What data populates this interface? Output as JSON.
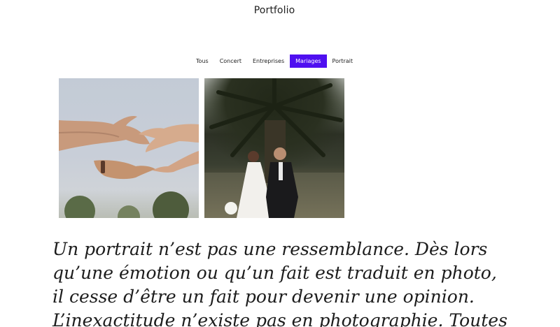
{
  "header": {
    "title": "Portfolio"
  },
  "filters": [
    {
      "label": "Tous",
      "active": false
    },
    {
      "label": "Concert",
      "active": false
    },
    {
      "label": "Entreprises",
      "active": false
    },
    {
      "label": "Mariages",
      "active": true
    },
    {
      "label": "Portrait",
      "active": false
    }
  ],
  "colors": {
    "accent": "#4f0ff0",
    "text": "#1b1b1b",
    "background": "#ffffff"
  },
  "quote": {
    "text": "Un portrait n’est pas une ressemblance. Dès lors qu’une émotion ou qu’un fait est traduit en photo, il cesse d’être un fait pour devenir une opinion. L’inexactitude n’existe pas en photographie. Toutes"
  }
}
